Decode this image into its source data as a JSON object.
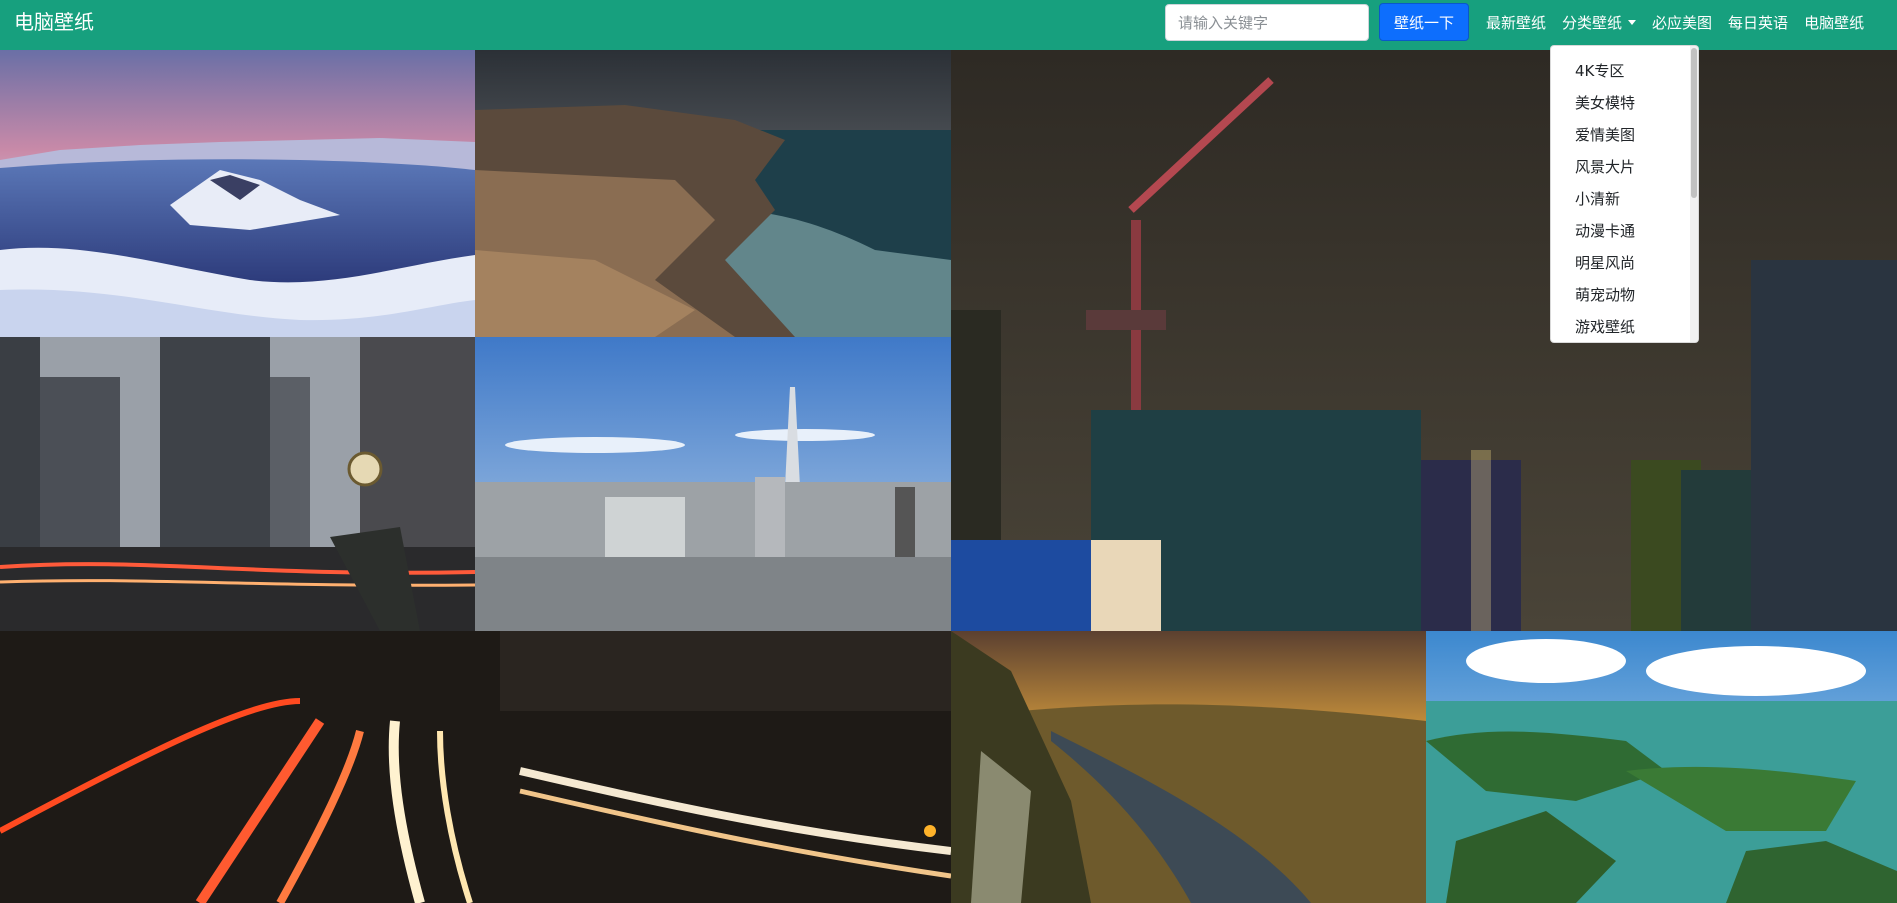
{
  "header": {
    "brand": "电脑壁纸",
    "search_placeholder": "请输入关键字",
    "search_button": "壁纸一下",
    "nav": [
      {
        "label": "最新壁纸"
      },
      {
        "label": "分类壁纸",
        "dropdown": true
      },
      {
        "label": "必应美图"
      },
      {
        "label": "每日英语"
      },
      {
        "label": "电脑壁纸"
      }
    ]
  },
  "dropdown": {
    "items": [
      "4K专区",
      "美女模特",
      "爱情美图",
      "风景大片",
      "小清新",
      "动漫卡通",
      "明星风尚",
      "萌宠动物",
      "游戏壁纸"
    ]
  },
  "gallery": {
    "tiles": [
      {
        "name": "crater-lake-snow"
      },
      {
        "name": "coastal-cliff-waves"
      },
      {
        "name": "city-night-crane"
      },
      {
        "name": "flatiron-street-clock"
      },
      {
        "name": "tokyo-skytree"
      },
      {
        "name": "highway-light-trails"
      },
      {
        "name": "river-valley-sunset"
      },
      {
        "name": "green-lake-islands"
      }
    ]
  }
}
